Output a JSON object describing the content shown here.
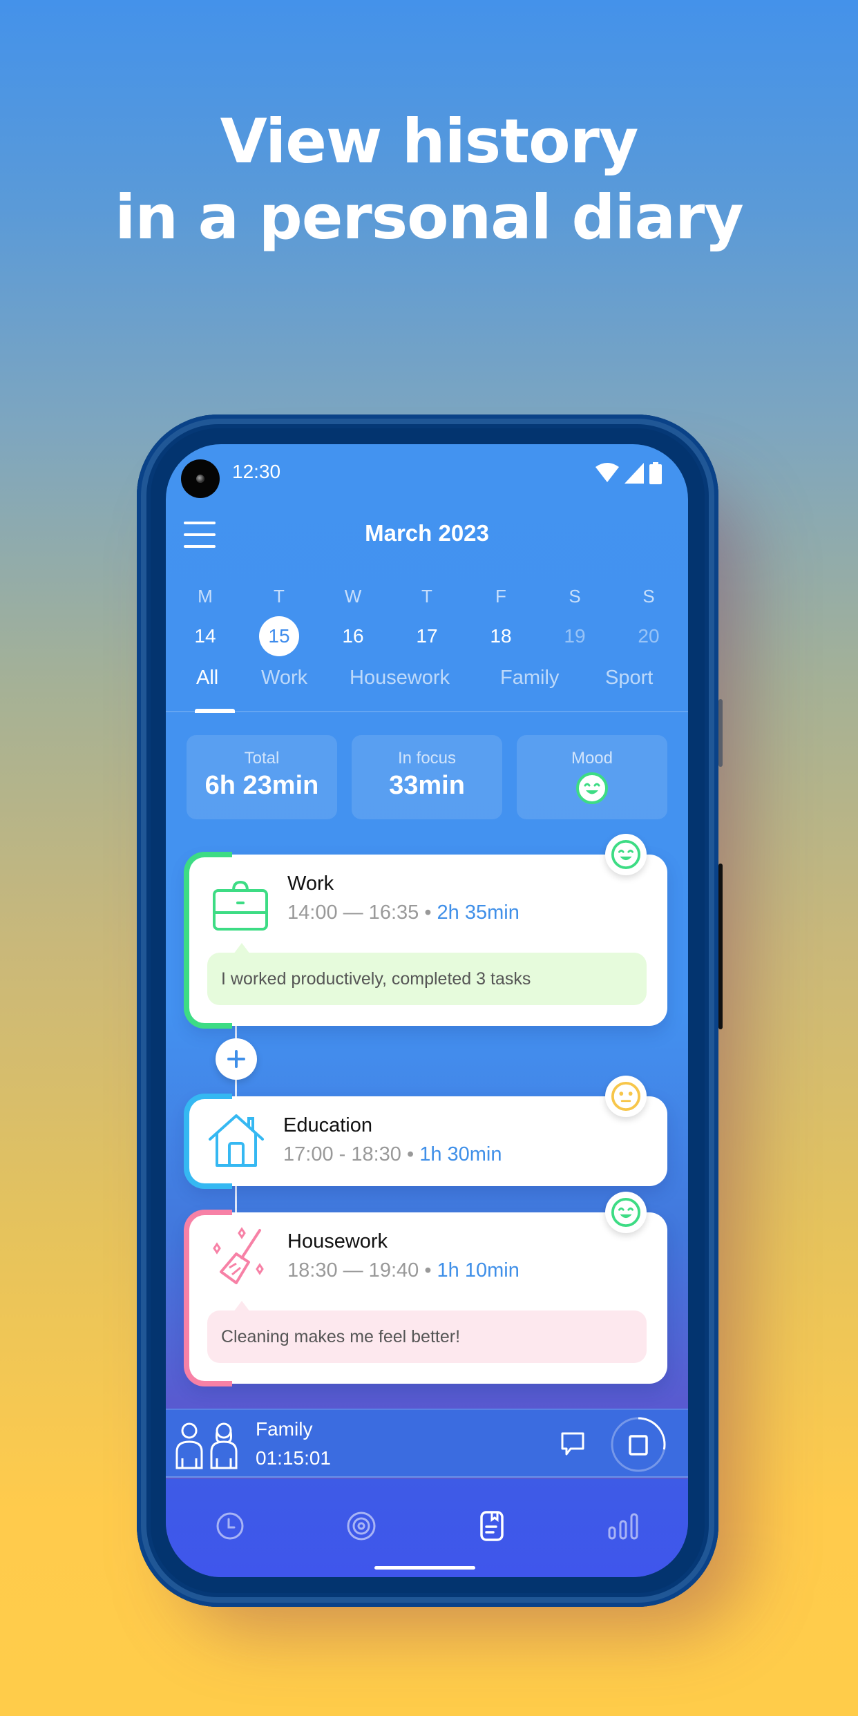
{
  "headline": {
    "line1": "View history",
    "line2": "in a personal diary"
  },
  "status_bar": {
    "time": "12:30",
    "icons": [
      "wifi-icon",
      "signal-icon",
      "battery-icon"
    ]
  },
  "header": {
    "menu_icon": "hamburger-menu-icon",
    "title": "March 2023"
  },
  "week": [
    {
      "name": "M",
      "num": "14",
      "state": "past"
    },
    {
      "name": "T",
      "num": "15",
      "state": "selected"
    },
    {
      "name": "W",
      "num": "16",
      "state": "past"
    },
    {
      "name": "T",
      "num": "17",
      "state": "past"
    },
    {
      "name": "F",
      "num": "18",
      "state": "past"
    },
    {
      "name": "S",
      "num": "19",
      "state": "future"
    },
    {
      "name": "S",
      "num": "20",
      "state": "future"
    }
  ],
  "tabs": [
    {
      "label": "All",
      "active": true
    },
    {
      "label": "Work",
      "active": false
    },
    {
      "label": "Housework",
      "active": false
    },
    {
      "label": "Family",
      "active": false
    },
    {
      "label": "Sport",
      "active": false
    }
  ],
  "stats": {
    "total": {
      "label": "Total",
      "value": "6h 23min"
    },
    "focus": {
      "label": "In focus",
      "value": "33min"
    },
    "mood": {
      "label": "Mood",
      "icon": "happy-face-icon",
      "color": "#3ddc84"
    }
  },
  "entries": [
    {
      "title": "Work",
      "time": "14:00 — 16:35",
      "separator": "•",
      "duration": "2h 35min",
      "icon": "briefcase-icon",
      "accent": "#3ddc84",
      "mood": "happy",
      "note": "I worked productively, completed 3 tasks",
      "note_bg": "#e6fbdc"
    },
    {
      "title": "Education",
      "time": "17:00 - 18:30",
      "separator": "•",
      "duration": "1h 30min",
      "icon": "house-icon",
      "accent": "#35b8f2",
      "mood": "neutral",
      "note": null
    },
    {
      "title": "Housework",
      "time": "18:30 — 19:40",
      "separator": "•",
      "duration": "1h 10min",
      "icon": "broom-sparkle-icon",
      "accent": "#f781a6",
      "mood": "happy",
      "note": "Cleaning makes me feel better!",
      "note_bg": "#fde8ee"
    }
  ],
  "mood_colors": {
    "happy": "#3ddc84",
    "neutral": "#f7c64a"
  },
  "add_button_icon": "plus-icon",
  "now_tracking": {
    "category": "Family",
    "timer": "01:15:01",
    "avatar_icon": "family-people-icon",
    "comment_icon": "comment-icon",
    "stop_icon": "stop-icon",
    "progress": 0.28
  },
  "bottom_nav": [
    {
      "name": "timer",
      "icon": "clock-icon",
      "active": false
    },
    {
      "name": "goals",
      "icon": "target-icon",
      "active": false
    },
    {
      "name": "diary",
      "icon": "diary-icon",
      "active": true
    },
    {
      "name": "stats",
      "icon": "bar-chart-icon",
      "active": false
    }
  ],
  "colors": {
    "accent_blue": "#3f8fe8",
    "screen_blue": "#4393f0"
  }
}
